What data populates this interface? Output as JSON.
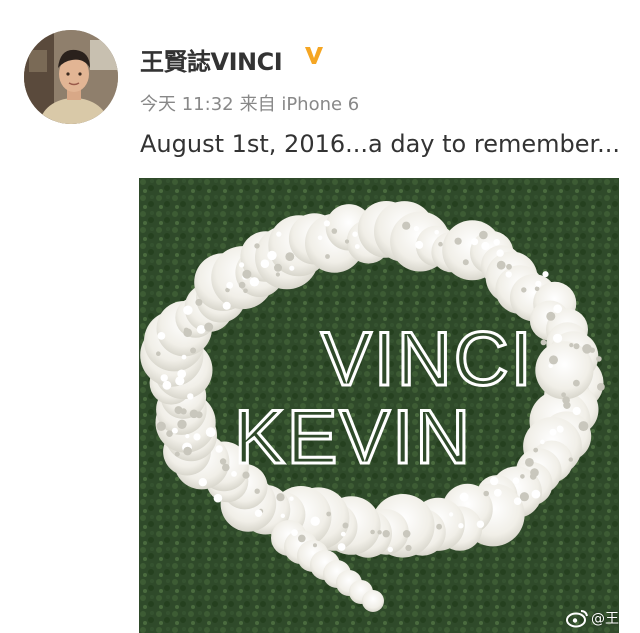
{
  "post": {
    "author": {
      "name": "王賢誌VINCI",
      "verified_icon": "verified-v-icon",
      "avatar_icon": "avatar-photo"
    },
    "meta": {
      "time": "今天 11:32",
      "source": "来自 iPhone 6"
    },
    "text": "August 1st, 2016...a day to remember...",
    "image": {
      "sign_line1": "VINCI",
      "sign_line2": "KEVIN",
      "watermark": "@王"
    }
  },
  "colors": {
    "text_primary": "#333333",
    "text_secondary": "#888888",
    "verified": "#f5a623",
    "hedge": "#2f4a2a",
    "flowers": "#f4f2ec"
  }
}
